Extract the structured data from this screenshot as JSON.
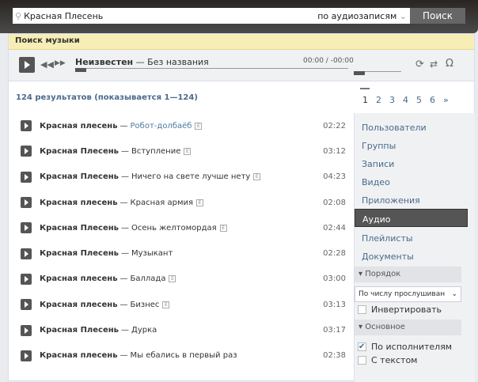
{
  "search": {
    "query": "Красная Плесень",
    "scope": "по аудиозаписям",
    "button": "Поиск"
  },
  "title": "Поиск музыки",
  "player": {
    "artist": "Неизвестен",
    "dash": "—",
    "title": "Без названия",
    "time": "00:00 / -00:00"
  },
  "results": {
    "count": "124 результатов (показывается 1—124)",
    "pages": [
      "1",
      "2",
      "3",
      "4",
      "5",
      "6",
      "»"
    ]
  },
  "tracks": [
    {
      "artist": "Красная плесень",
      "title": "Робот-долбаёб",
      "duration": "02:22",
      "link": true
    },
    {
      "artist": "Красная Плесень",
      "title": "Вступление",
      "duration": "03:12"
    },
    {
      "artist": "Красная Плесень",
      "title": "Ничего на свете лучше нету",
      "duration": "04:23"
    },
    {
      "artist": "Красная плесень",
      "title": "Красная армия",
      "duration": "02:08"
    },
    {
      "artist": "Красная Плесень",
      "title": "Осень желтомордая",
      "duration": "02:44"
    },
    {
      "artist": "Красная Плесень",
      "title": "Музыкант",
      "duration": "02:28",
      "noE": true
    },
    {
      "artist": "Красная плесень",
      "title": "Баллада",
      "duration": "03:00"
    },
    {
      "artist": "Красная плесень",
      "title": "Бизнес",
      "duration": "03:13"
    },
    {
      "artist": "Красная Плесень",
      "title": "Дурка",
      "duration": "03:17",
      "noE": true
    },
    {
      "artist": "Красная плесень",
      "title": "Мы ебались в первый раз",
      "duration": "02:38",
      "noE": true
    }
  ],
  "explicit_badge": "E",
  "sidebar": {
    "nav": [
      "Пользователи",
      "Группы",
      "Записи",
      "Видео",
      "Приложения",
      "Аудио",
      "Плейлисты",
      "Документы"
    ],
    "active": "Аудио",
    "order_label": "Порядок",
    "order_value": "По числу прослушиван",
    "invert": "Инвертировать",
    "main_label": "Основное",
    "by_artist": "По исполнителям",
    "with_text": "С текстом"
  }
}
